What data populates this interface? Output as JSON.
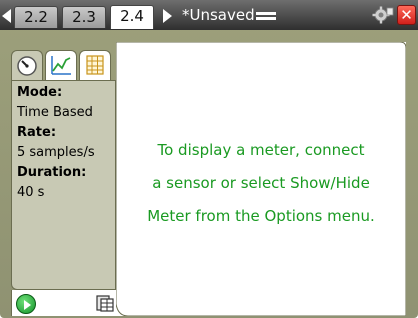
{
  "tabs": [
    {
      "label": "2.2",
      "active": false
    },
    {
      "label": "2.3",
      "active": false
    },
    {
      "label": "2.4",
      "active": true
    }
  ],
  "document": {
    "title": "*Unsaved"
  },
  "left_panel": {
    "mode_label": "Mode:",
    "mode_value": "Time Based",
    "rate_label": "Rate:",
    "rate_value": "5 samples/s",
    "duration_label": "Duration:",
    "duration_value": "40 s"
  },
  "main": {
    "message_lines": [
      "To display a meter, connect",
      "a sensor or select Show/Hide",
      "Meter from the Options menu."
    ]
  },
  "colors": {
    "frame": "#9da07b",
    "panel": "#c8c9b4",
    "message_text": "#1a9a22",
    "close_red": "#d0201b",
    "play_green": "#129228"
  },
  "icons": {
    "nav_left": "triangle-left-icon",
    "nav_right": "triangle-right-icon",
    "doc_menu": "document-menu-icon",
    "plugin": "gear-plugin-icon",
    "close": "close-icon",
    "meter_tab": "meter-gauge-icon",
    "graph_tab": "graph-icon",
    "table_tab": "table-icon",
    "start_collection": "play-icon",
    "collect_mode": "data-collection-icon"
  }
}
